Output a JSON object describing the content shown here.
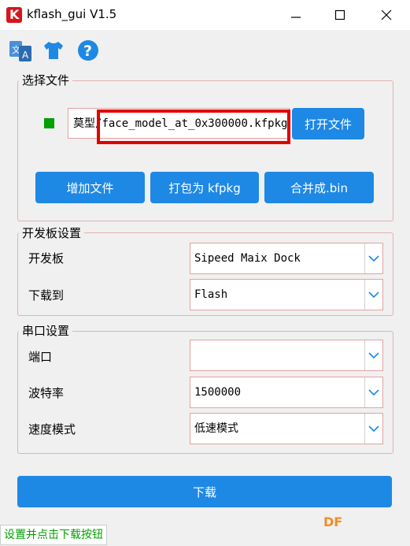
{
  "window": {
    "title": "kflash_gui V1.5"
  },
  "select_file": {
    "legend": "选择文件",
    "file_prefix": "莫型/",
    "file_name": "face_model_at_0x300000.kfpkg",
    "open_file_label": "打开文件",
    "add_file_label": "增加文件",
    "pack_kfpkg_label": "打包为 kfpkg",
    "merge_bin_label": "合并成.bin"
  },
  "board_settings": {
    "legend": "开发板设置",
    "board_label": "开发板",
    "board_value": "Sipeed Maix Dock",
    "download_to_label": "下载到",
    "download_to_value": "Flash"
  },
  "serial_settings": {
    "legend": "串口设置",
    "port_label": "端口",
    "port_value": "",
    "baud_label": "波特率",
    "baud_value": "1500000",
    "speed_label": "速度模式",
    "speed_value": "低速模式"
  },
  "download_label": "下载",
  "status_text": "设置并点击下载按钮",
  "watermark": "DF",
  "colors": {
    "accent": "#1e88e5",
    "status_green": "#00a000",
    "highlight_red": "#e00000"
  }
}
